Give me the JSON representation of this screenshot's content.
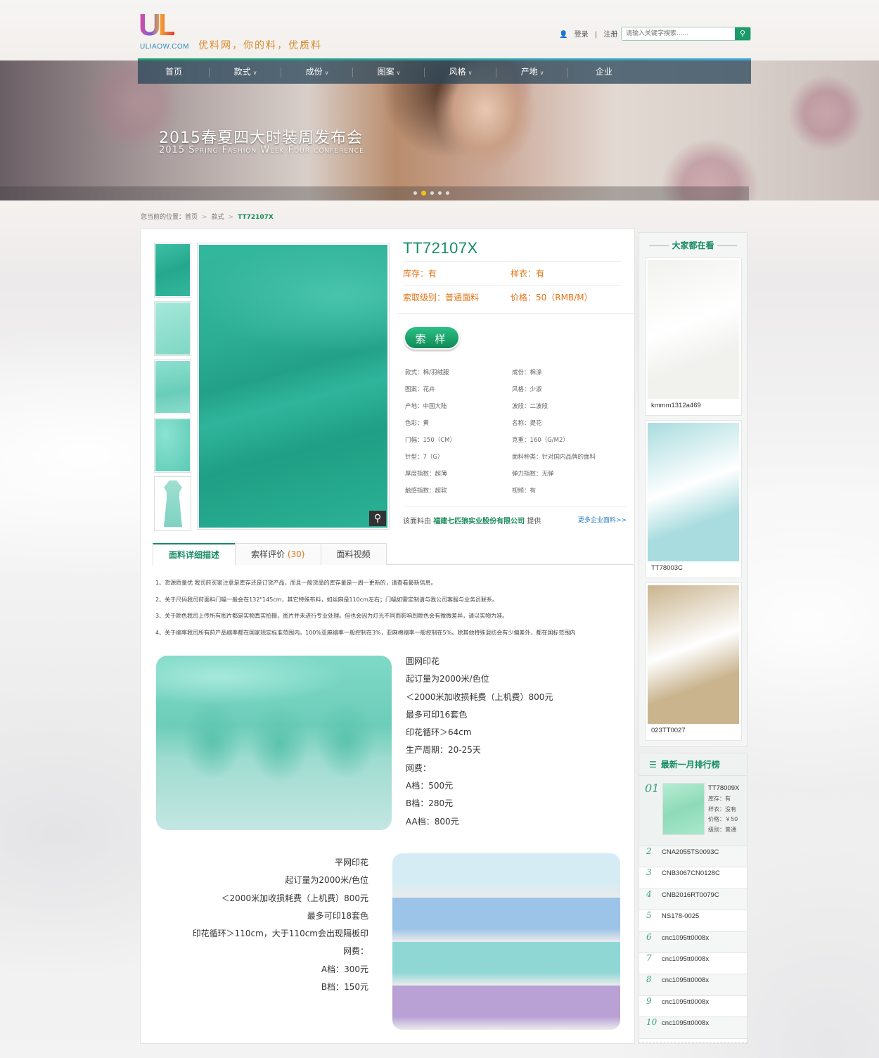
{
  "header": {
    "logo_mark": "UL",
    "logo_domain": "ULIAOW.COM",
    "slogan": "优料网，你的料，优质料",
    "login": "登录",
    "register": "注册",
    "search_placeholder": "请输入关键字搜索......"
  },
  "nav": [
    {
      "label": "首页",
      "dropdown": false
    },
    {
      "label": "款式",
      "dropdown": true
    },
    {
      "label": "成份",
      "dropdown": true
    },
    {
      "label": "图案",
      "dropdown": true
    },
    {
      "label": "风格",
      "dropdown": true
    },
    {
      "label": "产地",
      "dropdown": true
    },
    {
      "label": "企业",
      "dropdown": false
    }
  ],
  "banner": {
    "title": "2015春夏四大时装周发布会",
    "subtitle": "2015 Spring Fashion Week Four conference",
    "slides": 5,
    "active_slide": 2
  },
  "breadcrumb": {
    "label": "您当前的位置：",
    "items": [
      "首页",
      "款式",
      "TT72107X"
    ]
  },
  "product": {
    "code": "TT72107X",
    "stock": "库存：有",
    "sample_garment": "样衣：有",
    "sample_level": "索取级别：普通面料",
    "price": "价格：50（RMB/M）",
    "request_btn": "索 样",
    "specs": [
      "款式：棉/羽绒服",
      "成份：棉涤",
      "图案：花卉",
      "风格：少淑",
      "产地：中国大陆",
      "波段：二波段",
      "色彩：黄",
      "名称：提花",
      "门幅：150（CM）",
      "克重：160（G/M2）",
      "针型：7（G）",
      "面料种类：针对国内品牌的面料",
      "厚度指数：超薄",
      "弹力指数：无弹",
      "触感指数：超软",
      "视频：有"
    ],
    "supplier_prefix": "该面料由",
    "supplier_name": "福建七匹狼实业股份有限公司",
    "supplier_suffix": "提供",
    "more_link": "更多企业面料>>",
    "thumb_colors": [
      "#2fb59b",
      "#8fe1d0",
      "#7bd6c6",
      "#6dd5c3",
      "#9fe0d2"
    ]
  },
  "tabs": [
    {
      "label": "面料详细描述",
      "count": ""
    },
    {
      "label": "索样评价",
      "count": "(30)"
    },
    {
      "label": "面料视频",
      "count": ""
    }
  ],
  "notes": [
    "1、货源质量优 我司莳买家注意是库存还是订货产品，而且一般货品的库存量是一周一更新的，请查看最新信息。",
    "2、关于尺码我司莳面料门幅一般会在132\"145cm，其它特殊布料，如丝麻是110cm左右；门幅如需定制请与我公司客服与业务员联系。",
    "3、关于颜色我司上传所有图片都是实物真实拍摄，图片并未进行专业处理。但也会因为灯光不同而影响到颜色会有微微差异，请以实物为准。",
    "4、关于缩率我司所有莳产品缩率都在国家规定标准范围内。100%亚麻缩率一般控制在3%，亚麻棉缩率一般控制在5%。除其他特殊混纺会有少偏差外，都在国标范围内"
  ],
  "block1": [
    "圆网印花",
    "起订量为2000米/色位",
    "＜2000米加收损耗费（上机费）800元",
    "最多可印16套色",
    "印花循环＞64cm",
    "生产周期：20-25天",
    "网费：",
    "A档：500元",
    "B档：280元",
    "AA档：800元"
  ],
  "block2": [
    "平网印花",
    "起订量为2000米/色位",
    "＜2000米加收损耗费（上机费）800元",
    "最多可印18套色",
    "印花循环＞110cm，大于110cm会出现隔板印",
    "网费：",
    "A档：300元",
    "B档：150元"
  ],
  "block2_colors": [
    "#d6ecf4",
    "#9cc4e8",
    "#8fd7d5",
    "#b9a1d6"
  ],
  "sidebar": {
    "popular_title": "大家都在看",
    "popular": [
      {
        "code": "kmmm1312a469",
        "color": "#f1f1ee"
      },
      {
        "code": "TT78003C",
        "color": "#a9dcdf"
      },
      {
        "code": "023TT0027",
        "color": "#c9b48e"
      }
    ],
    "ranking_title": "最新一月排行榜",
    "top": {
      "no": "01",
      "code": "TT78009X",
      "stock": "库存：有",
      "sample": "样衣：没有",
      "price": "价格：￥50",
      "level": "级别：普通"
    },
    "ranking": [
      {
        "no": "2",
        "code": "CNA2055TS0093C"
      },
      {
        "no": "3",
        "code": "CNB3067CN0128C"
      },
      {
        "no": "4",
        "code": "CNB2016RT0079C"
      },
      {
        "no": "5",
        "code": "NS178-0025"
      },
      {
        "no": "6",
        "code": "cnc1095tt0008x"
      },
      {
        "no": "7",
        "code": "cnc1095tt0008x"
      },
      {
        "no": "8",
        "code": "cnc1095tt0008x"
      },
      {
        "no": "9",
        "code": "cnc1095tt0008x"
      },
      {
        "no": "10",
        "code": "cnc1095tt0008x"
      }
    ]
  }
}
